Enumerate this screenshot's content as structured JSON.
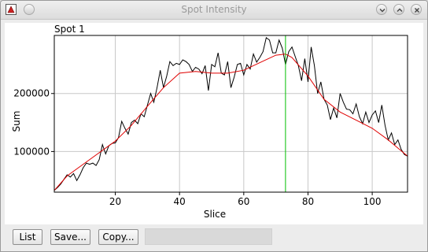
{
  "window": {
    "title": "Spot Intensity"
  },
  "buttons": {
    "list": "List",
    "save": "Save...",
    "copy": "Copy..."
  },
  "status": {
    "text": ""
  },
  "chart_data": {
    "type": "line",
    "title": "Spot 1",
    "xlabel": "Slice",
    "ylabel": "Sum",
    "xlim": [
      1,
      111
    ],
    "ylim": [
      30000,
      300000
    ],
    "xticks": [
      20,
      40,
      60,
      80,
      100
    ],
    "yticks": [
      100000,
      200000
    ],
    "ytick_labels": [
      "100000",
      "200000"
    ],
    "grid": true,
    "marker_x": 73,
    "colors": {
      "data": "#000000",
      "fit": "#e00000",
      "marker": "#00c000"
    },
    "series": [
      {
        "style": "raw",
        "x": [
          1,
          2,
          3,
          4,
          5,
          6,
          7,
          8,
          9,
          10,
          11,
          12,
          13,
          14,
          15,
          16,
          17,
          18,
          19,
          20,
          21,
          22,
          23,
          24,
          25,
          26,
          27,
          28,
          29,
          30,
          31,
          32,
          33,
          34,
          35,
          36,
          37,
          38,
          39,
          40,
          41,
          42,
          43,
          44,
          45,
          46,
          47,
          48,
          49,
          50,
          51,
          52,
          53,
          54,
          55,
          56,
          57,
          58,
          59,
          60,
          61,
          62,
          63,
          64,
          65,
          66,
          67,
          68,
          69,
          70,
          71,
          72,
          73,
          74,
          75,
          76,
          77,
          78,
          79,
          80,
          81,
          82,
          83,
          84,
          85,
          86,
          87,
          88,
          89,
          90,
          91,
          92,
          93,
          94,
          95,
          96,
          97,
          98,
          99,
          100,
          101,
          102,
          103,
          104,
          105,
          106,
          107,
          108,
          109,
          110,
          111
        ],
        "values": [
          33000,
          38000,
          44000,
          52000,
          60000,
          56000,
          62000,
          50000,
          60000,
          72000,
          80000,
          78000,
          80000,
          76000,
          86000,
          112000,
          96000,
          110000,
          114000,
          115000,
          124000,
          152000,
          140000,
          130000,
          150000,
          154000,
          148000,
          165000,
          160000,
          180000,
          200000,
          185000,
          210000,
          240000,
          210000,
          230000,
          255000,
          248000,
          252000,
          250000,
          258000,
          255000,
          250000,
          238000,
          245000,
          242000,
          234000,
          248000,
          205000,
          250000,
          246000,
          270000,
          235000,
          232000,
          255000,
          210000,
          228000,
          250000,
          252000,
          232000,
          250000,
          242000,
          268000,
          254000,
          262000,
          272000,
          296000,
          292000,
          270000,
          270000,
          292000,
          278000,
          250000,
          272000,
          280000,
          264000,
          248000,
          222000,
          260000,
          220000,
          280000,
          248000,
          200000,
          220000,
          190000,
          180000,
          155000,
          175000,
          158000,
          200000,
          185000,
          173000,
          172000,
          165000,
          182000,
          160000,
          148000,
          168000,
          150000,
          163000,
          170000,
          150000,
          180000,
          145000,
          120000,
          132000,
          112000,
          120000,
          104000,
          95000,
          92000
        ]
      },
      {
        "style": "fit",
        "x": [
          1,
          5,
          10,
          15,
          20,
          25,
          30,
          35,
          40,
          45,
          50,
          55,
          60,
          65,
          70,
          73,
          75,
          80,
          85,
          90,
          95,
          100,
          105,
          111
        ],
        "values": [
          33000,
          58000,
          78000,
          98000,
          118000,
          145000,
          178000,
          210000,
          235000,
          238000,
          235000,
          235000,
          240000,
          253000,
          266000,
          268000,
          262000,
          230000,
          190000,
          168000,
          154000,
          140000,
          120000,
          92000
        ]
      }
    ]
  }
}
